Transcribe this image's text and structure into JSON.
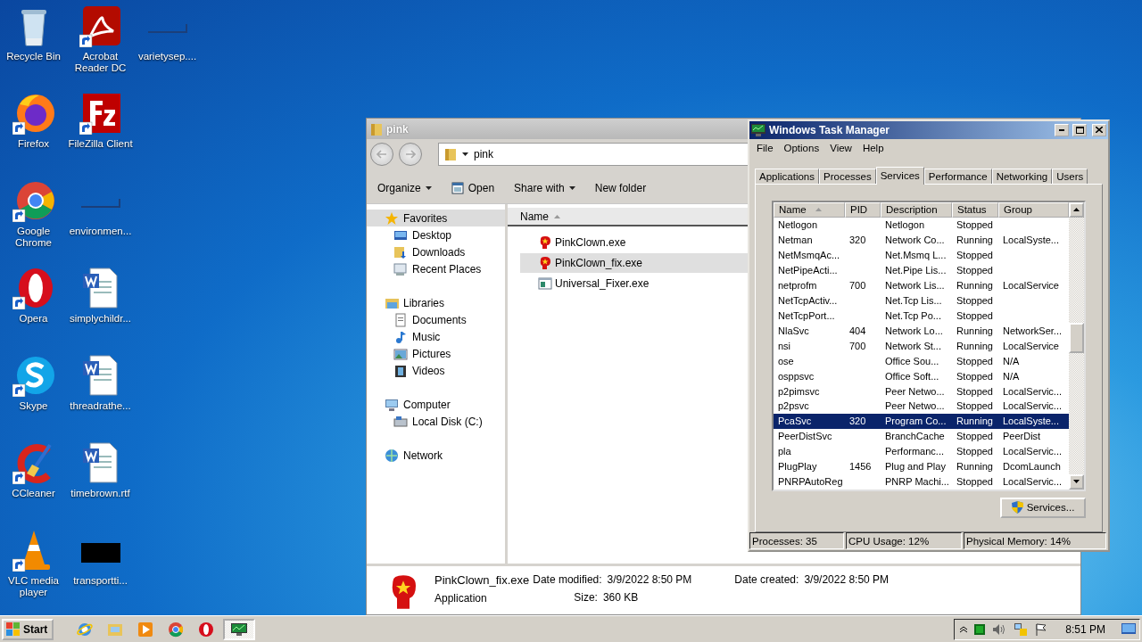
{
  "desktop": {
    "columns": [
      [
        {
          "label": "Recycle Bin",
          "kind": "recycle",
          "shortcut": false
        },
        {
          "label": "Firefox",
          "kind": "firefox",
          "shortcut": true
        },
        {
          "label": "Google Chrome",
          "kind": "chrome",
          "shortcut": true
        },
        {
          "label": "Opera",
          "kind": "opera",
          "shortcut": true
        },
        {
          "label": "Skype",
          "kind": "skype",
          "shortcut": true
        },
        {
          "label": "CCleaner",
          "kind": "ccleaner",
          "shortcut": true
        },
        {
          "label": "VLC media player",
          "kind": "vlc",
          "shortcut": true
        }
      ],
      [
        {
          "label": "Acrobat Reader DC",
          "kind": "acrobat",
          "shortcut": true
        },
        {
          "label": "FileZilla Client",
          "kind": "filezilla",
          "shortcut": true
        },
        {
          "label": "environmen...",
          "kind": "blank",
          "shortcut": false
        },
        {
          "label": "simplychildr...",
          "kind": "word",
          "shortcut": false
        },
        {
          "label": "threadrathe...",
          "kind": "word",
          "shortcut": false
        },
        {
          "label": "timebrown.rtf",
          "kind": "word",
          "shortcut": false
        },
        {
          "label": "transportti...",
          "kind": "black",
          "shortcut": false
        }
      ],
      [
        {
          "label": "varietysep....",
          "kind": "blank",
          "shortcut": false
        }
      ]
    ]
  },
  "explorer": {
    "title": "pink",
    "address": "pink",
    "toolbar": [
      {
        "label": "Organize",
        "kind": "menu"
      },
      {
        "label": "Open",
        "kind": "open"
      },
      {
        "label": "Share with",
        "kind": "menu"
      },
      {
        "label": "New folder",
        "kind": "plain"
      }
    ],
    "nav": [
      {
        "label": "Favorites",
        "kind": "star",
        "selected": true,
        "children": [
          {
            "label": "Desktop",
            "kind": "desktop",
            "selected": false
          },
          {
            "label": "Downloads",
            "kind": "downloads",
            "selected": false
          },
          {
            "label": "Recent Places",
            "kind": "recent",
            "selected": false
          }
        ]
      },
      {
        "label": "Libraries",
        "kind": "library",
        "selected": false,
        "children": [
          {
            "label": "Documents",
            "kind": "documents",
            "selected": false
          },
          {
            "label": "Music",
            "kind": "music",
            "selected": false
          },
          {
            "label": "Pictures",
            "kind": "pictures",
            "selected": false
          },
          {
            "label": "Videos",
            "kind": "videos",
            "selected": false
          }
        ]
      },
      {
        "label": "Computer",
        "kind": "computer",
        "selected": false,
        "children": [
          {
            "label": "Local Disk (C:)",
            "kind": "disk",
            "selected": false
          }
        ]
      },
      {
        "label": "Network",
        "kind": "network",
        "selected": false
      }
    ],
    "column": "Name",
    "files": [
      {
        "name": "PinkClown.exe",
        "kind": "clown",
        "selected": false
      },
      {
        "name": "PinkClown_fix.exe",
        "kind": "clown",
        "selected": true
      },
      {
        "name": "Universal_Fixer.exe",
        "kind": "app",
        "selected": false
      }
    ],
    "details": {
      "name": "PinkClown_fix.exe",
      "type": "Application",
      "modified_label": "Date modified:",
      "modified": "3/9/2022 8:50 PM",
      "size_label": "Size:",
      "size": "360 KB",
      "created_label": "Date created:",
      "created": "3/9/2022 8:50 PM"
    }
  },
  "task_manager": {
    "title": "Windows Task Manager",
    "menu": [
      "File",
      "Options",
      "View",
      "Help"
    ],
    "tabs": [
      {
        "label": "Applications",
        "selected": false
      },
      {
        "label": "Processes",
        "selected": false
      },
      {
        "label": "Services",
        "selected": true
      },
      {
        "label": "Performance",
        "selected": false
      },
      {
        "label": "Networking",
        "selected": false
      },
      {
        "label": "Users",
        "selected": false
      }
    ],
    "columns": [
      "Name",
      "PID",
      "Description",
      "Status",
      "Group"
    ],
    "rows": [
      {
        "name": "Netlogon",
        "pid": "",
        "description": "Netlogon",
        "status": "Stopped",
        "group": "",
        "selected": false
      },
      {
        "name": "Netman",
        "pid": "320",
        "description": "Network Co...",
        "status": "Running",
        "group": "LocalSyste...",
        "selected": false
      },
      {
        "name": "NetMsmqAc...",
        "pid": "",
        "description": "Net.Msmq L...",
        "status": "Stopped",
        "group": "",
        "selected": false
      },
      {
        "name": "NetPipeActi...",
        "pid": "",
        "description": "Net.Pipe Lis...",
        "status": "Stopped",
        "group": "",
        "selected": false
      },
      {
        "name": "netprofm",
        "pid": "700",
        "description": "Network Lis...",
        "status": "Running",
        "group": "LocalService",
        "selected": false
      },
      {
        "name": "NetTcpActiv...",
        "pid": "",
        "description": "Net.Tcp Lis...",
        "status": "Stopped",
        "group": "",
        "selected": false
      },
      {
        "name": "NetTcpPort...",
        "pid": "",
        "description": "Net.Tcp Po...",
        "status": "Stopped",
        "group": "",
        "selected": false
      },
      {
        "name": "NlaSvc",
        "pid": "404",
        "description": "Network Lo...",
        "status": "Running",
        "group": "NetworkSer...",
        "selected": false
      },
      {
        "name": "nsi",
        "pid": "700",
        "description": "Network St...",
        "status": "Running",
        "group": "LocalService",
        "selected": false
      },
      {
        "name": "ose",
        "pid": "",
        "description": "Office  Sou...",
        "status": "Stopped",
        "group": "N/A",
        "selected": false
      },
      {
        "name": "osppsvc",
        "pid": "",
        "description": "Office Soft...",
        "status": "Stopped",
        "group": "N/A",
        "selected": false
      },
      {
        "name": "p2pimsvc",
        "pid": "",
        "description": "Peer Netwo...",
        "status": "Stopped",
        "group": "LocalServic...",
        "selected": false
      },
      {
        "name": "p2psvc",
        "pid": "",
        "description": "Peer Netwo...",
        "status": "Stopped",
        "group": "LocalServic...",
        "selected": false
      },
      {
        "name": "PcaSvc",
        "pid": "320",
        "description": "Program Co...",
        "status": "Running",
        "group": "LocalSyste...",
        "selected": true
      },
      {
        "name": "PeerDistSvc",
        "pid": "",
        "description": "BranchCache",
        "status": "Stopped",
        "group": "PeerDist",
        "selected": false
      },
      {
        "name": "pla",
        "pid": "",
        "description": "Performanc...",
        "status": "Stopped",
        "group": "LocalServic...",
        "selected": false
      },
      {
        "name": "PlugPlay",
        "pid": "1456",
        "description": "Plug and Play",
        "status": "Running",
        "group": "DcomLaunch",
        "selected": false
      },
      {
        "name": "PNRPAutoReg",
        "pid": "",
        "description": "PNRP Machi...",
        "status": "Stopped",
        "group": "LocalServic...",
        "selected": false
      }
    ],
    "button": "Services...",
    "status": [
      "Processes: 35",
      "CPU Usage: 12%",
      "Physical Memory: 14%"
    ]
  },
  "taskbar": {
    "start": "Start",
    "apps": [
      {
        "kind": "ie",
        "selected": false
      },
      {
        "kind": "explorer",
        "selected": false
      },
      {
        "kind": "media",
        "selected": false
      },
      {
        "kind": "chrome",
        "selected": false
      },
      {
        "kind": "opera",
        "selected": false
      },
      {
        "kind": "taskmgr",
        "selected": true
      }
    ],
    "clock": "8:51 PM"
  }
}
